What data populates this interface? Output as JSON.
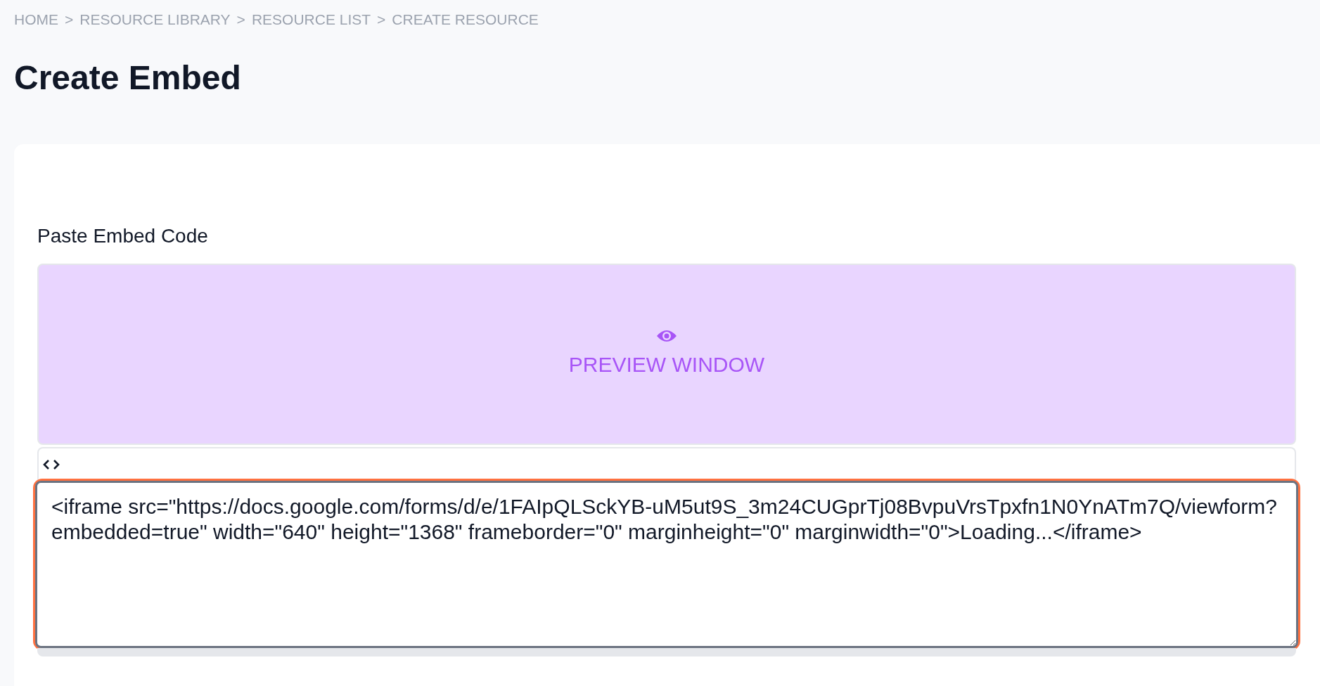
{
  "breadcrumb": {
    "items": [
      "HOME",
      "RESOURCE LIBRARY",
      "RESOURCE LIST",
      "CREATE RESOURCE"
    ],
    "separator": ">"
  },
  "page_title": "Create Embed",
  "form": {
    "label": "Paste Embed Code",
    "preview": {
      "label": "PREVIEW WINDOW"
    },
    "code_field": {
      "value": "<iframe src=\"https://docs.google.com/forms/d/e/1FAIpQLSckYB-uM5ut9S_3m24CUGprTj08BvpuVrsTpxfn1N0YnATm7Q/viewform?embedded=true\" width=\"640\" height=\"1368\" frameborder=\"0\" marginheight=\"0\" marginwidth=\"0\">Loading...</iframe>",
      "focused": true
    }
  }
}
